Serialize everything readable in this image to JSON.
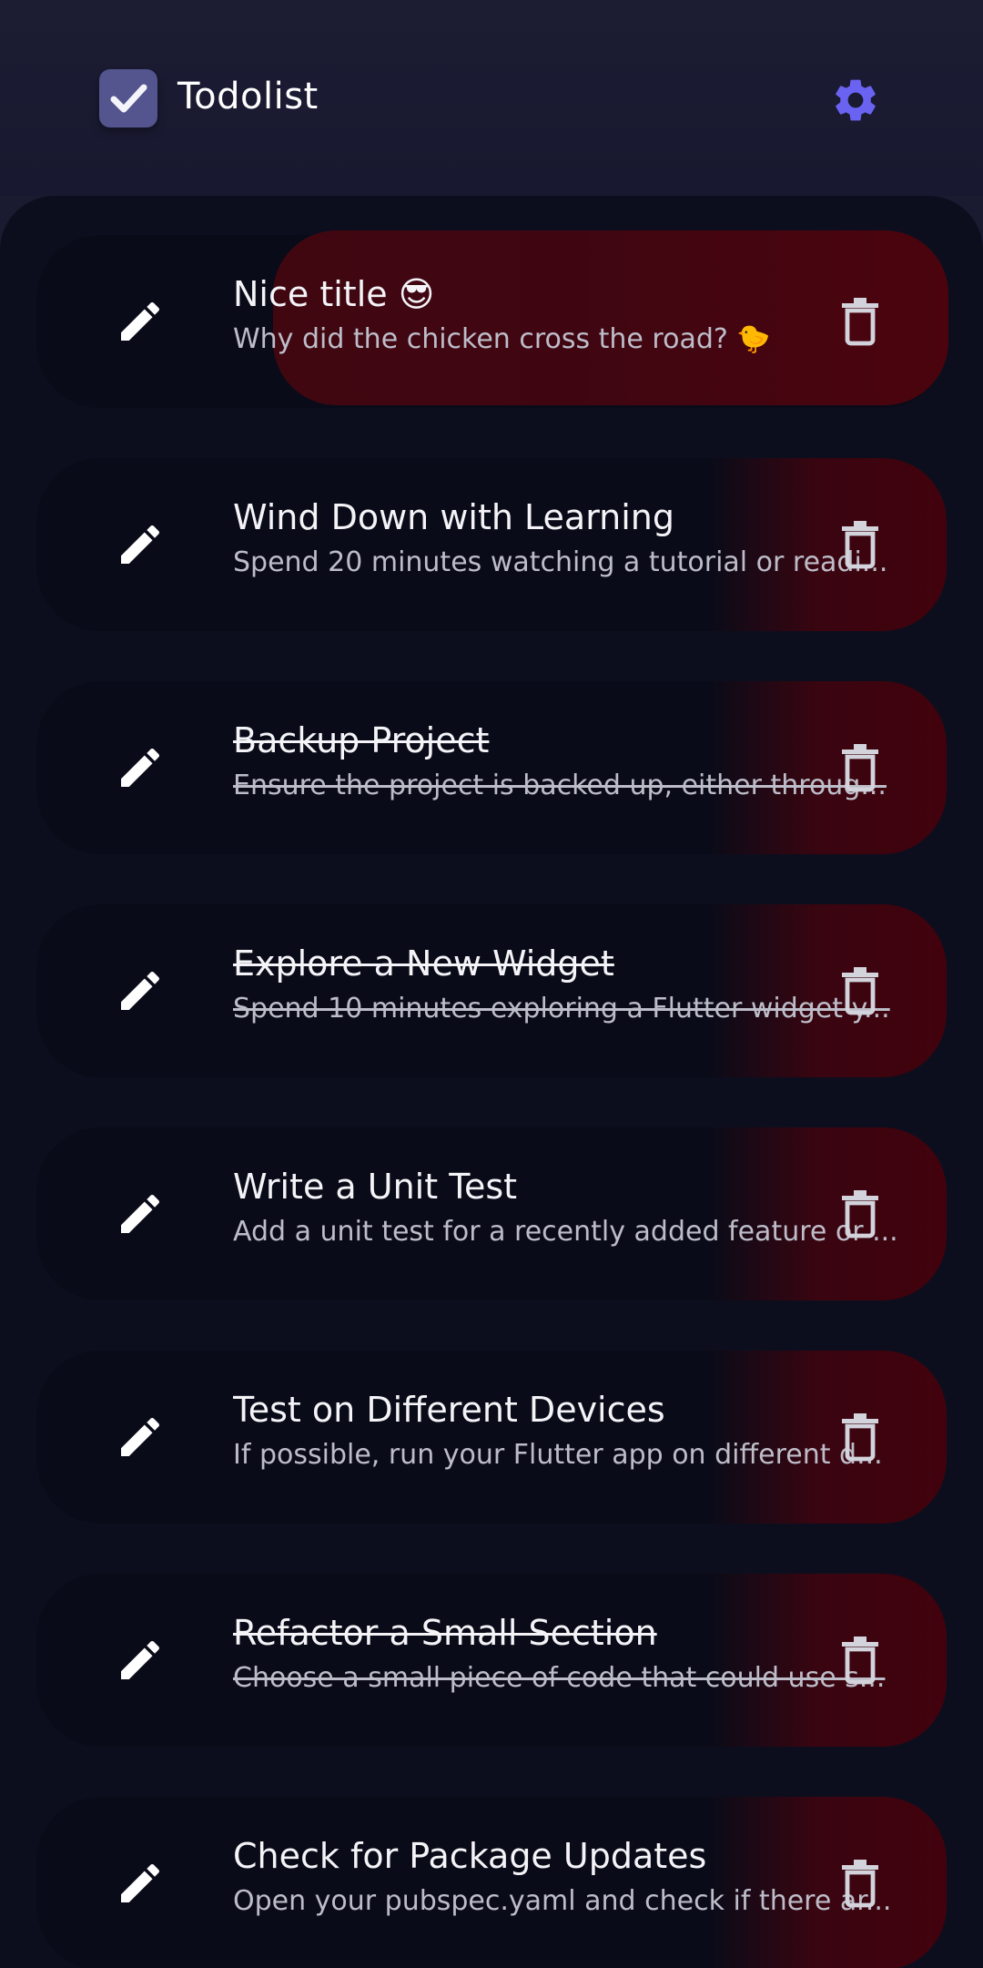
{
  "app": {
    "title": "Todolist",
    "logo_icon": "checkbox-checked-icon",
    "settings_icon": "gear-icon",
    "accent": "#6a63f2"
  },
  "tasks": [
    {
      "title": "Nice title 😎",
      "description": "Why did the chicken cross the road? 🐤",
      "done": false,
      "swiped": true
    },
    {
      "title": "Wind Down with Learning",
      "description": "Spend 20 minutes watching a tutorial or readi...",
      "done": false
    },
    {
      "title": "Backup Project",
      "description": "Ensure the project is backed up, either throug...",
      "done": true
    },
    {
      "title": "Explore a New Widget",
      "description": "Spend 10 minutes exploring a Flutter widget y...",
      "done": true
    },
    {
      "title": "Write a Unit Test",
      "description": "Add a unit test for a recently added feature or ...",
      "done": false
    },
    {
      "title": "Test on Different Devices",
      "description": "If possible, run your Flutter app on different d...",
      "done": false
    },
    {
      "title": "Refactor a Small Section",
      "description": "Choose a small piece of code that could use s...",
      "done": true
    },
    {
      "title": "Check for Package Updates",
      "description": "Open your pubspec.yaml and check if there ar...",
      "done": false
    }
  ],
  "icons": {
    "edit": "pencil-icon",
    "delete": "trash-icon"
  },
  "colors": {
    "background": "#0d0e1d",
    "card": "#0a0b18",
    "delete_red": "#4a0610"
  }
}
